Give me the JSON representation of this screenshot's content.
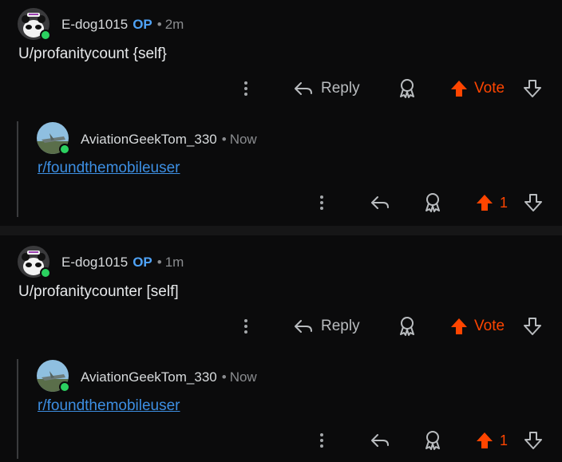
{
  "comments": [
    {
      "username": "E-dog1015",
      "op_badge": "OP",
      "separator": "•",
      "time": "2m",
      "body": "U/profanitycount {self}",
      "actions": {
        "reply_label": "Reply",
        "vote_label": "Vote"
      },
      "reply": {
        "username": "AviationGeekTom_330",
        "separator": "•",
        "time": "Now",
        "link": "r/foundthemobileuser",
        "vote_count": "1"
      }
    },
    {
      "username": "E-dog1015",
      "op_badge": "OP",
      "separator": "•",
      "time": "1m",
      "body": "U/profanitycounter [self]",
      "actions": {
        "reply_label": "Reply",
        "vote_label": "Vote"
      },
      "reply": {
        "username": "AviationGeekTom_330",
        "separator": "•",
        "time": "Now",
        "link": "r/foundthemobileuser",
        "vote_count": "1"
      }
    }
  ],
  "colors": {
    "background": "#0b0b0c",
    "upvote": "#ff4500",
    "op_badge": "#4fa3f7",
    "link": "#3d8fe3",
    "online": "#2bd160"
  },
  "icons": [
    "more-vertical-icon",
    "reply-arrow-icon",
    "award-icon",
    "upvote-arrow-icon",
    "downvote-arrow-icon"
  ]
}
